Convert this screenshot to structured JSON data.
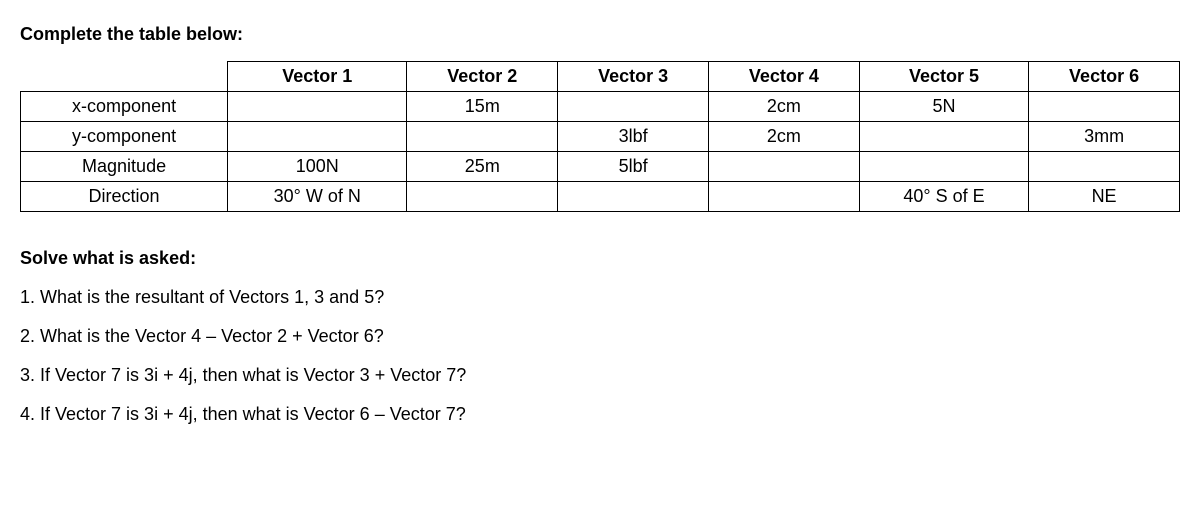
{
  "heading": "Complete the table below:",
  "table": {
    "cornerBlank": "",
    "headers": [
      "Vector 1",
      "Vector 2",
      "Vector 3",
      "Vector 4",
      "Vector 5",
      "Vector 6"
    ],
    "rows": [
      {
        "label": "x-component",
        "cells": [
          "",
          "15m",
          "",
          "2cm",
          "5N",
          ""
        ]
      },
      {
        "label": "y-component",
        "cells": [
          "",
          "",
          "3lbf",
          "2cm",
          "",
          "3mm"
        ]
      },
      {
        "label": "Magnitude",
        "cells": [
          "100N",
          "25m",
          "5lbf",
          "",
          "",
          ""
        ]
      },
      {
        "label": "Direction",
        "cells": [
          "30° W of N",
          "",
          "",
          "",
          "40° S of E",
          "NE"
        ]
      }
    ]
  },
  "solveHeading": "Solve what is asked:",
  "questions": [
    "1. What is the resultant of Vectors 1, 3 and 5?",
    "2. What is the Vector 4 – Vector 2 + Vector 6?",
    "3. If Vector 7 is 3i + 4j, then what is Vector 3 + Vector 7?",
    "4. If Vector 7 is 3i + 4j, then what is Vector 6 – Vector 7?"
  ]
}
